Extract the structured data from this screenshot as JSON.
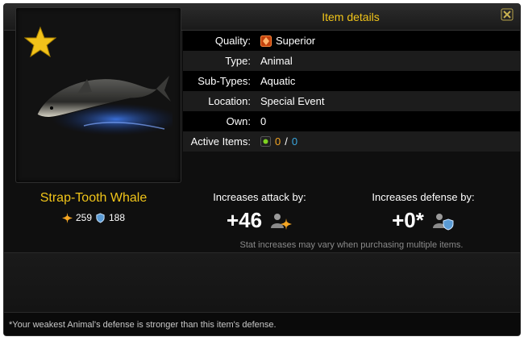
{
  "header": {
    "title": "Item details"
  },
  "item": {
    "name": "Strap-Tooth Whale",
    "attack": "259",
    "defense": "188"
  },
  "details": {
    "quality_label": "Quality:",
    "quality_value": "Superior",
    "type_label": "Type:",
    "type_value": "Animal",
    "subtype_label": "Sub-Types:",
    "subtype_value": "Aquatic",
    "location_label": "Location:",
    "location_value": "Special Event",
    "own_label": "Own:",
    "own_value": "0",
    "active_label": "Active Items:",
    "active_value_a": "0",
    "active_sep": "/",
    "active_value_b": "0"
  },
  "boosts": {
    "attack_label": "Increases attack by:",
    "attack_value": "+46",
    "defense_label": "Increases defense by:",
    "defense_value": "+0*",
    "note": "Stat increases may vary when purchasing multiple items."
  },
  "footer": {
    "text": "*Your weakest Animal's defense is stronger than this item's defense."
  },
  "colors": {
    "accent": "#f0c419",
    "orange": "#f5a623",
    "blue": "#3aa8e0"
  },
  "icons": [
    "close-icon",
    "star-icon",
    "attack-icon",
    "defense-icon",
    "quality-gem-icon",
    "active-item-icon"
  ]
}
